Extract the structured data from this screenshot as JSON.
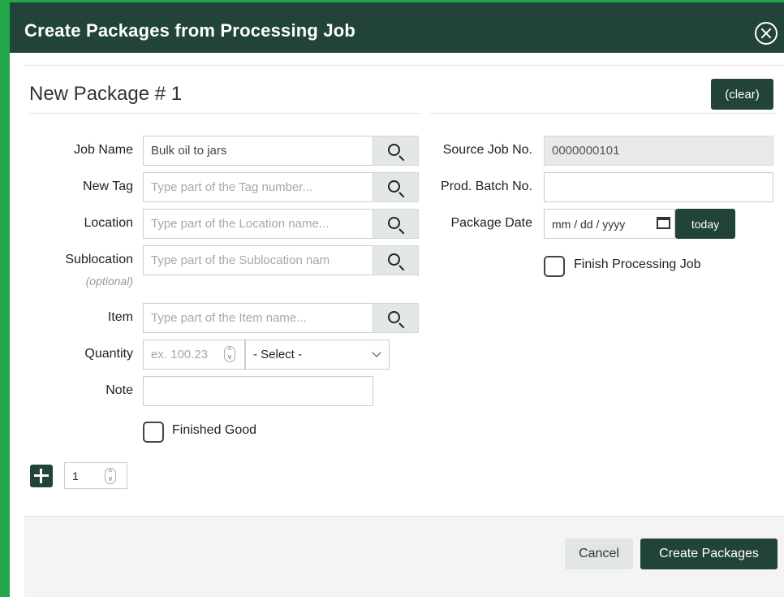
{
  "dialog": {
    "title": "Create Packages from Processing Job",
    "section_title": "New Package # 1",
    "clear_label": "(clear)"
  },
  "left_form": {
    "job_name": {
      "label": "Job Name",
      "value": "Bulk oil to jars"
    },
    "new_tag": {
      "label": "New Tag",
      "placeholder": "Type part of the Tag number..."
    },
    "location": {
      "label": "Location",
      "placeholder": "Type part of the Location name..."
    },
    "sublocation": {
      "label": "Sublocation",
      "sublabel": "(optional)",
      "placeholder": "Type part of the Sublocation nam"
    },
    "item": {
      "label": "Item",
      "placeholder": "Type part of the Item name..."
    },
    "quantity": {
      "label": "Quantity",
      "placeholder": "ex. 100.23",
      "unit_select": "- Select -"
    },
    "note": {
      "label": "Note",
      "value": ""
    },
    "finished_good": {
      "label": "Finished Good",
      "checked": false
    }
  },
  "right_form": {
    "source_job_no": {
      "label": "Source Job No.",
      "value": "0000000101"
    },
    "prod_batch_no": {
      "label": "Prod. Batch No.",
      "value": ""
    },
    "package_date": {
      "label": "Package Date",
      "placeholder": "mm / dd / yyyy",
      "today_label": "today"
    },
    "finish_processing_job": {
      "label": "Finish Processing Job",
      "checked": false
    }
  },
  "add_row": {
    "count": "1"
  },
  "footer": {
    "cancel_label": "Cancel",
    "create_label": "Create Packages"
  },
  "colors": {
    "header": "#22433a",
    "edge": "#21a64a"
  }
}
